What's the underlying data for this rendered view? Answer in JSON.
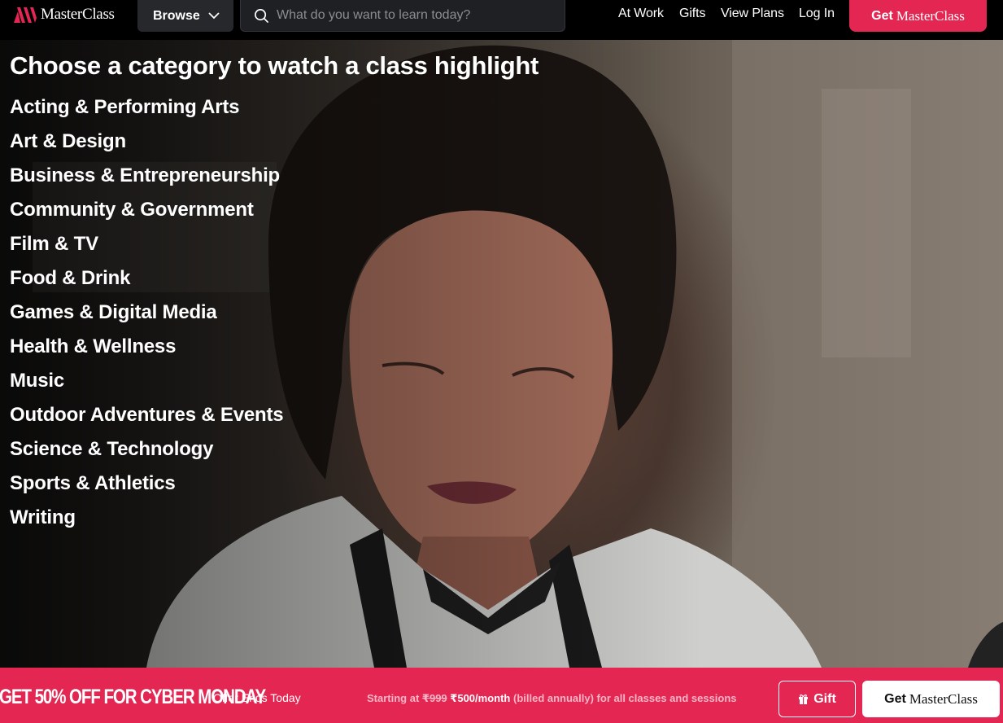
{
  "header": {
    "logo_text": "MasterClass",
    "browse_label": "Browse",
    "search_placeholder": "What do you want to learn today?",
    "nav": [
      "At Work",
      "Gifts",
      "View Plans",
      "Log In"
    ],
    "cta_prefix": "Get",
    "cta_brand": "MasterClass"
  },
  "hero": {
    "title": "Choose a category to watch a class highlight",
    "categories": [
      "Acting & Performing Arts",
      "Art & Design",
      "Business & Entrepreneurship",
      "Community & Government",
      "Film & TV",
      "Food & Drink",
      "Games & Digital Media",
      "Health & Wellness",
      "Music",
      "Outdoor Adventures & Events",
      "Science & Technology",
      "Sports & Athletics",
      "Writing"
    ]
  },
  "promo": {
    "headline": "GET 50% OFF FOR CYBER MONDAY",
    "offer_ends": "Offer Ends Today",
    "price_prefix": "Starting at",
    "price_old": "₹999",
    "price_new": "₹500/month",
    "price_suffix": "(billed annually) for all classes and sessions",
    "gift_label": "Gift",
    "cta_prefix": "Get",
    "cta_brand": "MasterClass"
  },
  "colors": {
    "brand": "#e32652",
    "header_bg": "#000000",
    "browse_bg": "#27282c",
    "search_bg": "#1f2023"
  },
  "icons": {
    "logo": "masterclass-logo-icon",
    "browse": "chevron-down-icon",
    "search": "search-icon",
    "gift": "gift-icon"
  }
}
